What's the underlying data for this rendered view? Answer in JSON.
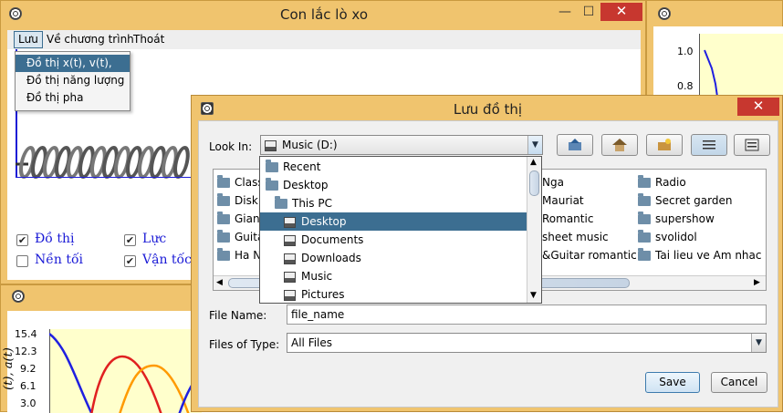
{
  "main_window": {
    "title": "Con lắc lò xo",
    "min_glyph": "—",
    "max_glyph": "☐",
    "close_glyph": "✕",
    "menu": [
      "Lưu",
      "Về chương trình",
      "Thoát"
    ],
    "popup_items": [
      "Đồ thị x(t), v(t), a(t)",
      "Đồ thị năng lượng",
      "Đồ thị pha"
    ],
    "checkboxes": [
      {
        "label": "Đồ thị",
        "checked": true
      },
      {
        "label": "Lực",
        "checked": true
      },
      {
        "label": "Nền tối",
        "checked": false
      },
      {
        "label": "Vận tốc",
        "checked": true
      }
    ]
  },
  "right_panel": {
    "y_ticks": [
      "1.0",
      "0.8"
    ]
  },
  "bottom_chart": {
    "ylabel": "(t), a(t)",
    "y_ticks": [
      "15.4",
      "12.3",
      "9.2",
      "6.1",
      "3.0"
    ]
  },
  "dialog": {
    "title": "Lưu đồ thị",
    "look_in_label": "Look In:",
    "look_in_value": "Music (D:)",
    "file_name_label": "File Name:",
    "file_name_value": "file_name",
    "files_of_type_label": "Files of Type:",
    "files_of_type_value": "All Files",
    "save_label": "Save",
    "cancel_label": "Cancel",
    "close_glyph": "✕",
    "files_col1": [
      "Class",
      "Disk",
      "Giang",
      "Guita",
      "Ha N"
    ],
    "files_col2": [
      "Nga",
      "Mauriat",
      "Romantic",
      "sheet music",
      "&Guitar romantic"
    ],
    "files_col3": [
      "Radio",
      "Secret garden",
      "supershow",
      "svolidol",
      "Tai lieu ve Am nhac"
    ],
    "dropdown_items": [
      {
        "label": "Recent",
        "icon": "folder"
      },
      {
        "label": "Desktop",
        "icon": "folder"
      },
      {
        "label": "This PC",
        "icon": "folder"
      },
      {
        "label": "Desktop",
        "icon": "drive",
        "selected": true
      },
      {
        "label": "Documents",
        "icon": "drive"
      },
      {
        "label": "Downloads",
        "icon": "drive"
      },
      {
        "label": "Music",
        "icon": "drive"
      },
      {
        "label": "Pictures",
        "icon": "drive"
      }
    ]
  },
  "colors": {
    "frame": "#f0c46e",
    "selection": "#3c6e91",
    "close_red": "#c7372f",
    "chart_bg": "#ffffcc",
    "series_blue": "#1f1fe0",
    "series_red": "#e02020",
    "series_orange": "#ff9a00"
  }
}
